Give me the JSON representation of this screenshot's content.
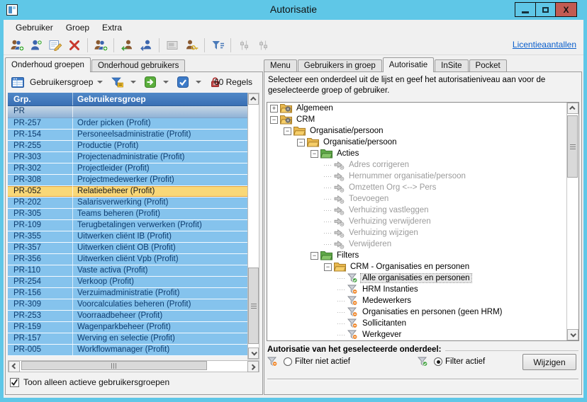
{
  "window": {
    "title": "Autorisatie"
  },
  "menubar": {
    "items": [
      "Gebruiker",
      "Groep",
      "Extra"
    ]
  },
  "main_toolbar": {
    "link": "Licentieaantallen",
    "items": [
      {
        "name": "add-group-button",
        "icon": "users_add"
      },
      {
        "name": "add-user-button",
        "icon": "user_add"
      },
      {
        "name": "edit-button",
        "icon": "edit"
      },
      {
        "name": "delete-button",
        "icon": "delete"
      },
      {
        "type": "sep"
      },
      {
        "name": "copy-group-button",
        "icon": "users_add"
      },
      {
        "type": "sep"
      },
      {
        "name": "move-user-in-button",
        "icon": "user_arrow_green"
      },
      {
        "name": "move-user-out-button",
        "icon": "user_arrow_blue"
      },
      {
        "type": "sep"
      },
      {
        "name": "preview-button",
        "icon": "preview",
        "disabled": true
      },
      {
        "name": "user-key-button",
        "icon": "user_key"
      },
      {
        "type": "sep"
      },
      {
        "name": "filter-button",
        "icon": "filter_lines"
      },
      {
        "type": "sep"
      },
      {
        "name": "properties-button",
        "icon": "sliders",
        "disabled": true
      },
      {
        "name": "properties-alt-button",
        "icon": "sliders",
        "disabled": true
      }
    ]
  },
  "left_panel": {
    "tabs": [
      {
        "label": "Onderhoud groepen",
        "active": true
      },
      {
        "label": "Onderhoud gebruikers",
        "active": false
      }
    ],
    "toolbar": {
      "view_label": "Gebruikersgroep",
      "count": "60 Regels"
    },
    "table": {
      "columns": [
        "Grp.",
        "Gebruikersgroep"
      ],
      "rows": [
        {
          "code": "PR",
          "name": "",
          "group": true
        },
        {
          "code": "PR-257",
          "name": "Order picken (Profit)"
        },
        {
          "code": "PR-154",
          "name": "Personeelsadministratie (Profit)"
        },
        {
          "code": "PR-255",
          "name": "Productie (Profit)"
        },
        {
          "code": "PR-303",
          "name": "Projectenadministratie (Profit)"
        },
        {
          "code": "PR-302",
          "name": "Projectleider (Profit)"
        },
        {
          "code": "PR-308",
          "name": "Projectmedewerker (Profit)"
        },
        {
          "code": "PR-052",
          "name": "Relatiebeheer (Profit)",
          "selected": true
        },
        {
          "code": "PR-202",
          "name": "Salarisverwerking (Profit)"
        },
        {
          "code": "PR-305",
          "name": "Teams beheren (Profit)"
        },
        {
          "code": "PR-109",
          "name": "Terugbetalingen verwerken (Profit)"
        },
        {
          "code": "PR-355",
          "name": "Uitwerken cliënt IB (Profit)"
        },
        {
          "code": "PR-357",
          "name": "Uitwerken cliënt OB (Profit)"
        },
        {
          "code": "PR-356",
          "name": "Uitwerken cliënt Vpb (Profit)"
        },
        {
          "code": "PR-110",
          "name": "Vaste activa (Profit)"
        },
        {
          "code": "PR-254",
          "name": "Verkoop (Profit)"
        },
        {
          "code": "PR-156",
          "name": "Verzuimadministratie (Profit)"
        },
        {
          "code": "PR-309",
          "name": "Voorcalculaties beheren (Profit)"
        },
        {
          "code": "PR-253",
          "name": "Voorraadbeheer (Profit)"
        },
        {
          "code": "PR-159",
          "name": "Wagenparkbeheer (Profit)"
        },
        {
          "code": "PR-157",
          "name": "Werving en selectie (Profit)"
        },
        {
          "code": "PR-005",
          "name": "Workflowmanager (Profit)"
        }
      ]
    },
    "footer_checkbox": {
      "label": "Toon alleen actieve gebruikersgroepen",
      "checked": true
    }
  },
  "right_panel": {
    "tabs": [
      {
        "label": "Menu",
        "active": false
      },
      {
        "label": "Gebruikers in groep",
        "active": false
      },
      {
        "label": "Autorisatie",
        "active": true
      },
      {
        "label": "InSite",
        "active": false
      },
      {
        "label": "Pocket",
        "active": false
      }
    ],
    "instruction": "Selecteer een onderdeel uit de lijst en geef het autorisatieniveau aan voor de geselecteerde groep of gebruiker.",
    "tree": [
      {
        "level": 0,
        "expand": "+",
        "icon": "module",
        "label": "Algemeen"
      },
      {
        "level": 0,
        "expand": "-",
        "icon": "module",
        "label": "CRM"
      },
      {
        "level": 1,
        "expand": "-",
        "icon": "folder",
        "label": "Organisatie/persoon"
      },
      {
        "level": 2,
        "expand": "-",
        "icon": "folder",
        "label": "Organisatie/persoon"
      },
      {
        "level": 3,
        "expand": "-",
        "icon": "folder_green",
        "label": "Acties"
      },
      {
        "level": 4,
        "icon": "action",
        "label": "Adres corrigeren",
        "dim": true
      },
      {
        "level": 4,
        "icon": "action",
        "label": "Hernummer organisatie/persoon",
        "dim": true
      },
      {
        "level": 4,
        "icon": "action",
        "label": "Omzetten Org <--> Pers",
        "dim": true
      },
      {
        "level": 4,
        "icon": "action",
        "label": "Toevoegen",
        "dim": true
      },
      {
        "level": 4,
        "icon": "action",
        "label": "Verhuizing vastleggen",
        "dim": true
      },
      {
        "level": 4,
        "icon": "action",
        "label": "Verhuizing verwijderen",
        "dim": true
      },
      {
        "level": 4,
        "icon": "action",
        "label": "Verhuizing wijzigen",
        "dim": true
      },
      {
        "level": 4,
        "icon": "action",
        "label": "Verwijderen",
        "dim": true
      },
      {
        "level": 3,
        "expand": "-",
        "icon": "folder_green",
        "label": "Filters"
      },
      {
        "level": 4,
        "expand": "-",
        "icon": "folder",
        "label": "CRM - Organisaties en personen"
      },
      {
        "level": 5,
        "icon": "filter_check",
        "label": "Alle organisaties en personen",
        "selected": true
      },
      {
        "level": 5,
        "icon": "filter_minus",
        "label": "HRM Instanties"
      },
      {
        "level": 5,
        "icon": "filter_minus",
        "label": "Medewerkers"
      },
      {
        "level": 5,
        "icon": "filter_minus",
        "label": "Organisaties en personen (geen HRM)"
      },
      {
        "level": 5,
        "icon": "filter_minus",
        "label": "Sollicitanten"
      },
      {
        "level": 5,
        "icon": "filter_minus",
        "label": "Werkgever"
      }
    ],
    "auth": {
      "title": "Autorisatie van het geselecteerde onderdeel:",
      "options": [
        {
          "label": "Filter niet actief",
          "icon": "filter_minus",
          "selected": false
        },
        {
          "label": "Filter actief",
          "icon": "filter_check",
          "selected": true
        }
      ],
      "button": "Wijzigen"
    }
  },
  "colors": {
    "window_frame": "#5FC7E7",
    "close_button": "#C25B52",
    "table_header": "#3A6FB4",
    "row_blue": "#85C3ED",
    "row_selected": "#F9D878",
    "link_blue": "#0B5FCC"
  }
}
